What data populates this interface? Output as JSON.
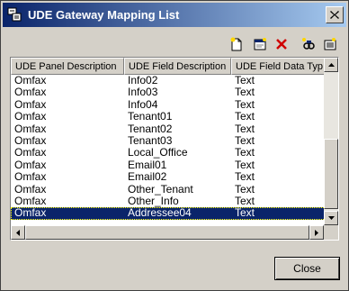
{
  "window": {
    "title": "UDE Gateway Mapping List",
    "close_button_label": "Close"
  },
  "toolbar": {
    "buttons": [
      {
        "icon": "new-document-icon"
      },
      {
        "icon": "edit-properties-icon"
      },
      {
        "icon": "delete-icon"
      },
      {
        "icon": "find-icon"
      },
      {
        "icon": "list-settings-icon"
      }
    ]
  },
  "grid": {
    "columns": [
      "UDE Panel Description",
      "UDE Field Description",
      "UDE Field Data Typ"
    ],
    "rows": [
      [
        "Omfax",
        "Info02",
        "Text"
      ],
      [
        "Omfax",
        "Info03",
        "Text"
      ],
      [
        "Omfax",
        "Info04",
        "Text"
      ],
      [
        "Omfax",
        "Tenant01",
        "Text"
      ],
      [
        "Omfax",
        "Tenant02",
        "Text"
      ],
      [
        "Omfax",
        "Tenant03",
        "Text"
      ],
      [
        "Omfax",
        "Local_Office",
        "Text"
      ],
      [
        "Omfax",
        "Email01",
        "Text"
      ],
      [
        "Omfax",
        "Email02",
        "Text"
      ],
      [
        "Omfax",
        "Other_Tenant",
        "Text"
      ],
      [
        "Omfax",
        "Other_Info",
        "Text"
      ],
      [
        "Omfax",
        "Addressee04",
        "Text"
      ]
    ],
    "selected_row": 11
  },
  "colors": {
    "title_start": "#0a246a",
    "title_end": "#a6caf0",
    "selection": "#0a246a",
    "delete_red": "#d00000"
  }
}
